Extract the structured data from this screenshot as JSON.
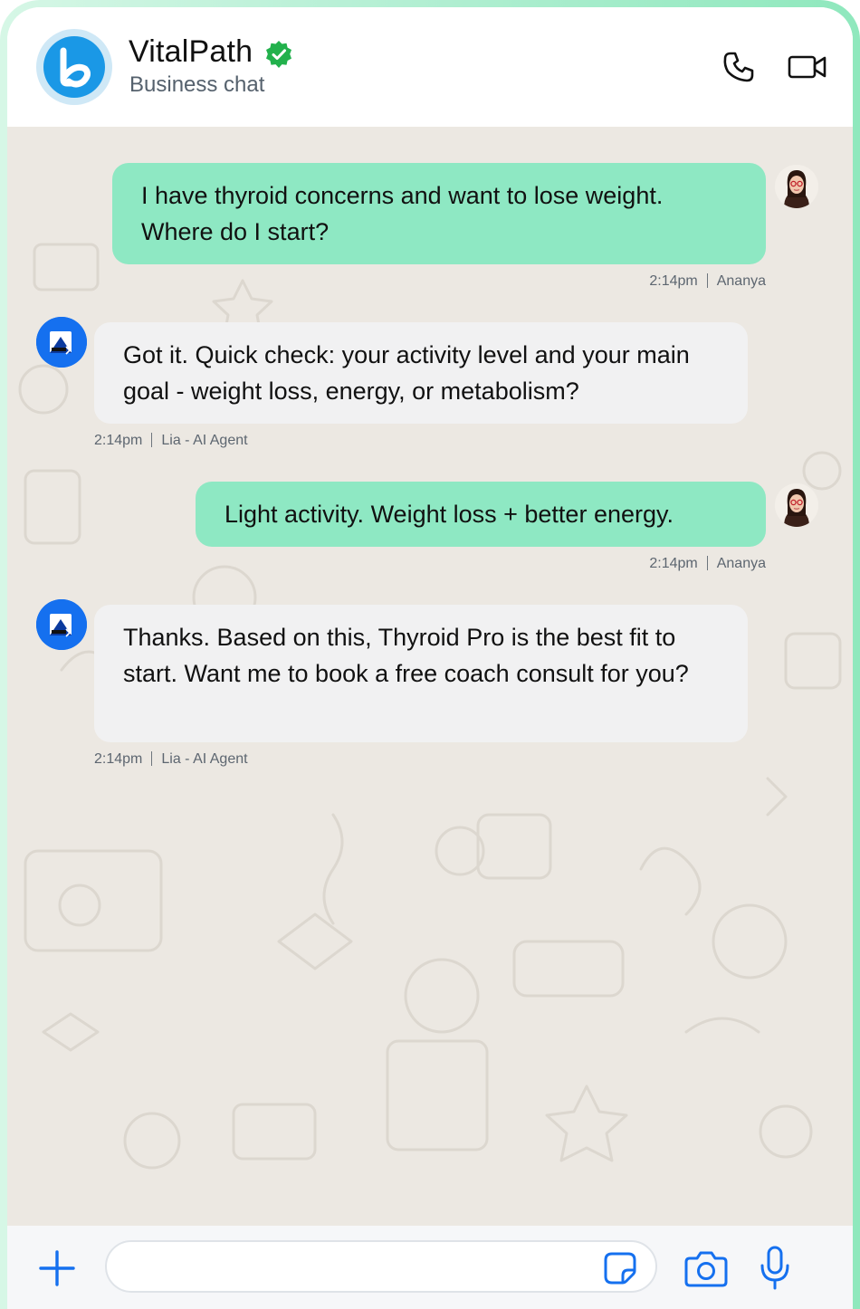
{
  "header": {
    "name": "VitalPath",
    "subtitle": "Business chat",
    "verified_icon": "verified-badge-icon",
    "actions": [
      "phone-icon",
      "video-icon"
    ]
  },
  "messages": [
    {
      "direction": "outgoing",
      "text": "I have thyroid concerns and want to lose weight. Where do I start?",
      "time": "2:14pm",
      "sender": "Ananya"
    },
    {
      "direction": "incoming",
      "text": "Got it. Quick check: your activity level and your main goal - weight loss, energy, or metabolism?",
      "time": "2:14pm",
      "sender": "Lia - AI Agent"
    },
    {
      "direction": "outgoing",
      "text": "Light activity. Weight loss + better energy.",
      "time": "2:14pm",
      "sender": "Ananya"
    },
    {
      "direction": "incoming",
      "text": "Thanks. Based on this, Thyroid Pro is the best fit to start. Want me to book a free coach consult for you?",
      "time": "2:14pm",
      "sender": "Lia - AI Agent"
    }
  ],
  "composer": {
    "value": "",
    "icons": [
      "plus-icon",
      "sticker-icon",
      "camera-icon",
      "mic-icon"
    ]
  },
  "colors": {
    "outgoing_bubble": "#8ee8c3",
    "incoming_bubble": "#f1f1f2",
    "chat_background": "#ece8e2",
    "accent_blue": "#1570ef",
    "verified_green": "#22b14c"
  }
}
